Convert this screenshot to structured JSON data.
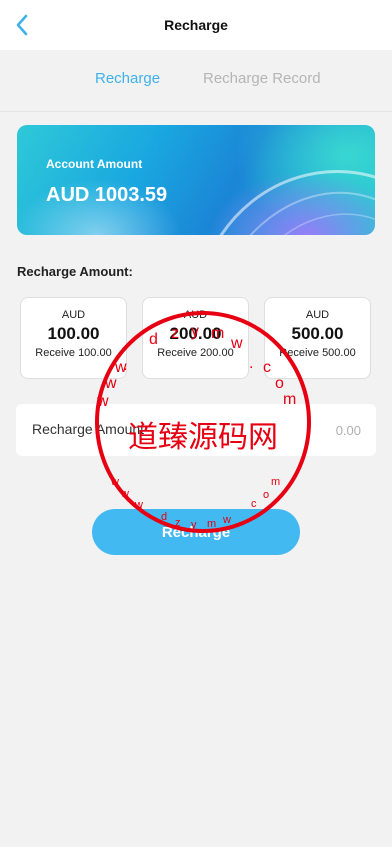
{
  "header": {
    "title": "Recharge",
    "back_icon": "chevron-left-icon"
  },
  "tabs": [
    {
      "label": "Recharge",
      "active": true
    },
    {
      "label": "Recharge Record",
      "active": false
    }
  ],
  "account_card": {
    "label": "Account Amount",
    "amount": "AUD 1003.59"
  },
  "recharge_amount_label": "Recharge Amount:",
  "options": [
    {
      "currency": "AUD",
      "value": "100.00",
      "receive": "Receive 100.00"
    },
    {
      "currency": "AUD",
      "value": "200.00",
      "receive": "Receive 200.00"
    },
    {
      "currency": "AUD",
      "value": "500.00",
      "receive": "Receive 500.00"
    }
  ],
  "input": {
    "label": "Recharge Amount",
    "placeholder": "0.00",
    "value": ""
  },
  "submit_label": "Recharge",
  "watermark": {
    "main_text": "道臻源码网",
    "letters": "www.dzymw.com",
    "color": "#e60012"
  },
  "colors": {
    "accent": "#42b9f0",
    "tab_active": "#3fb1ea",
    "tab_inactive": "#b5b5b5"
  }
}
